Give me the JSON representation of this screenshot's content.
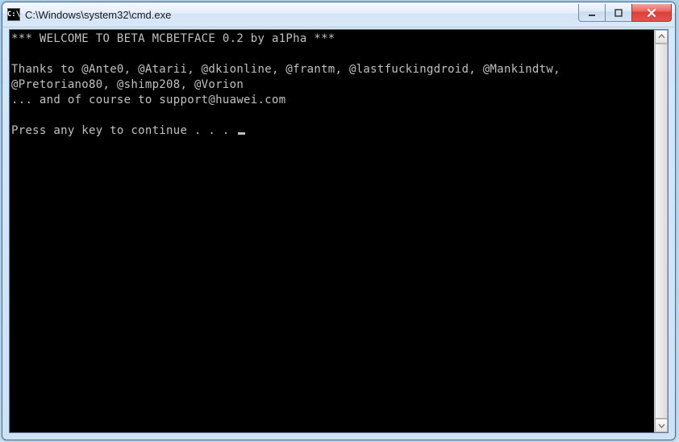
{
  "window": {
    "icon_text": "C:\\",
    "title": "C:\\Windows\\system32\\cmd.exe"
  },
  "terminal": {
    "line1": "*** WELCOME TO BETA MCBETFACE 0.2 by a1Pha ***",
    "line2": "",
    "line3": "Thanks to @Ante0, @Atarii, @dkionline, @frantm, @lastfuckingdroid, @Mankindtw, @Pretoriano80, @shimp208, @Vorion",
    "line4": "... and of course to support@huawei.com",
    "line5": "",
    "line6": "Press any key to continue . . . "
  }
}
